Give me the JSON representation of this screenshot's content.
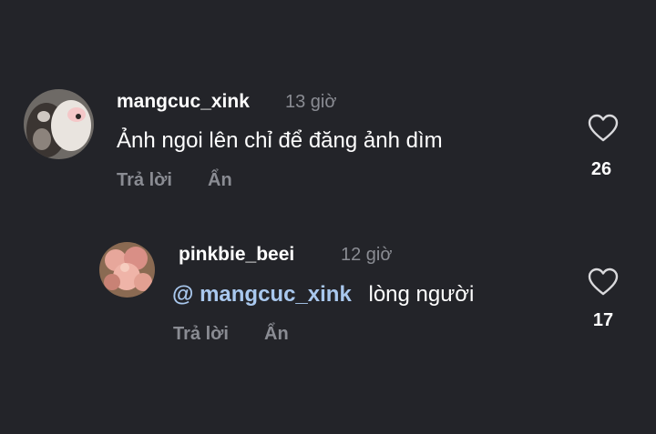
{
  "comments": [
    {
      "username": "mangcuc_xink",
      "time": "13 giờ",
      "text": "Ảnh ngoi lên chỉ để đăng ảnh dìm",
      "reply_label": "Trả lời",
      "hide_label": "Ẩn",
      "likes": "26"
    },
    {
      "username": "pinkbie_beei",
      "time": "12 giờ",
      "mention": "@ mangcuc_xink",
      "text": "lòng người",
      "reply_label": "Trả lời",
      "hide_label": "Ẩn",
      "likes": "17"
    }
  ],
  "colors": {
    "background": "#232429",
    "secondary_text": "#8a8c93",
    "mention": "#a9c8ee"
  },
  "icons": {
    "like": "heart-outline-icon"
  }
}
